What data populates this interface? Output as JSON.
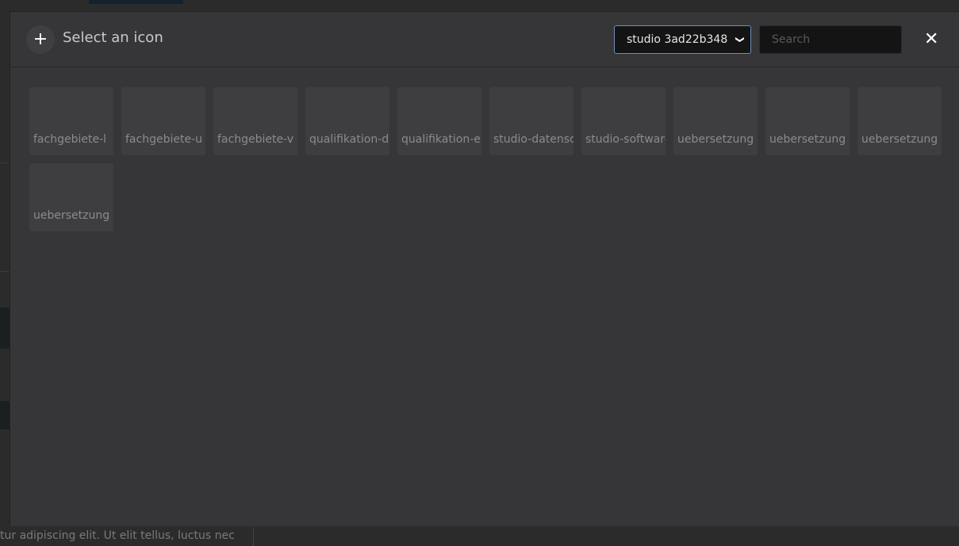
{
  "background": {
    "text": "tur adipiscing elit. Ut elit tellus, luctus nec"
  },
  "modal": {
    "title": "Select an icon",
    "add_icon": "+",
    "collection_select": {
      "value": "studio 3ad22b348"
    },
    "search": {
      "value": "",
      "placeholder": "Search"
    },
    "close_icon": "✕",
    "icons": [
      {
        "label": "fachgebiete-l"
      },
      {
        "label": "fachgebiete-u"
      },
      {
        "label": "fachgebiete-v"
      },
      {
        "label": "qualifikation-d"
      },
      {
        "label": "qualifikation-e"
      },
      {
        "label": "studio-datenschutz"
      },
      {
        "label": "studio-software"
      },
      {
        "label": "uebersetzung"
      },
      {
        "label": "uebersetzung"
      },
      {
        "label": "uebersetzung"
      },
      {
        "label": "uebersetzung"
      }
    ]
  }
}
